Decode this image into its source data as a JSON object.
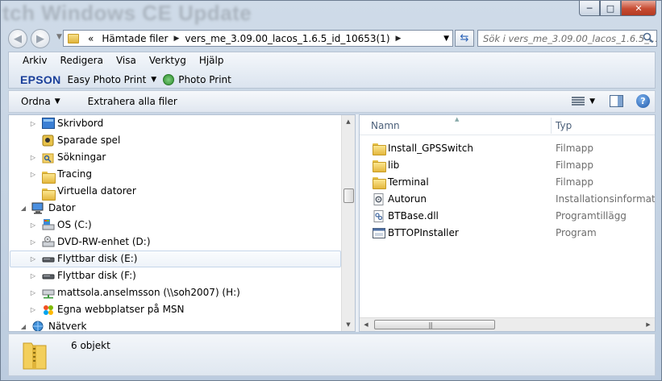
{
  "window": {
    "title": "tch Windows CE Update",
    "buttons": {
      "minimize": "─",
      "maximize": "□",
      "close": "✕"
    }
  },
  "address": {
    "overflow": "«",
    "segments": [
      "Hämtade filer",
      "vers_me_3.09.00_lacos_1.6.5_id_10653(1)"
    ],
    "search_placeholder": "Sök i vers_me_3.09.00_lacos_1.6.5_..."
  },
  "menu": {
    "items": [
      "Arkiv",
      "Redigera",
      "Visa",
      "Verktyg",
      "Hjälp"
    ]
  },
  "epson": {
    "logo": "EPSON",
    "easy_photo_print": "Easy Photo Print",
    "photo_print": "Photo Print"
  },
  "commandbar": {
    "organize": "Ordna",
    "extract_all": "Extrahera alla filer"
  },
  "navtree": {
    "items": [
      {
        "label": "Skrivbord",
        "icon": "desktop-icon",
        "expander": "▷"
      },
      {
        "label": "Sparade spel",
        "icon": "saved-games-icon",
        "expander": ""
      },
      {
        "label": "Sökningar",
        "icon": "searches-folder-icon",
        "expander": "▷"
      },
      {
        "label": "Tracing",
        "icon": "folder-icon",
        "expander": "▷"
      },
      {
        "label": "Virtuella datorer",
        "icon": "folder-icon",
        "expander": ""
      },
      {
        "label": "Dator",
        "icon": "computer-icon",
        "expander": "◢"
      },
      {
        "label": "OS (C:)",
        "icon": "drive-c-icon",
        "expander": "▷"
      },
      {
        "label": "DVD-RW-enhet (D:)",
        "icon": "dvd-drive-icon",
        "expander": "▷"
      },
      {
        "label": "Flyttbar disk (E:)",
        "icon": "removable-disk-icon",
        "expander": "▷"
      },
      {
        "label": "Flyttbar disk (F:)",
        "icon": "removable-disk-icon",
        "expander": "▷"
      },
      {
        "label": "mattsola.anselmsson (\\\\soh2007) (H:)",
        "icon": "network-drive-icon",
        "expander": "▷"
      },
      {
        "label": "Egna webbplatser på MSN",
        "icon": "msn-icon",
        "expander": "▷"
      },
      {
        "label": "Nätverk",
        "icon": "network-icon",
        "expander": "◢"
      }
    ]
  },
  "filelist": {
    "columns": {
      "name": "Namn",
      "type": "Typ"
    },
    "files": [
      {
        "name": "Install_GPSSwitch",
        "type": "Filmapp",
        "icon": "folder-icon"
      },
      {
        "name": "lib",
        "type": "Filmapp",
        "icon": "folder-icon"
      },
      {
        "name": "Terminal",
        "type": "Filmapp",
        "icon": "folder-icon"
      },
      {
        "name": "Autorun",
        "type": "Installationsinformation",
        "icon": "setup-info-icon"
      },
      {
        "name": "BTBase.dll",
        "type": "Programtillägg",
        "icon": "dll-icon"
      },
      {
        "name": "BTTOPInstaller",
        "type": "Program",
        "icon": "application-icon"
      }
    ]
  },
  "status": {
    "count": "6 objekt"
  }
}
